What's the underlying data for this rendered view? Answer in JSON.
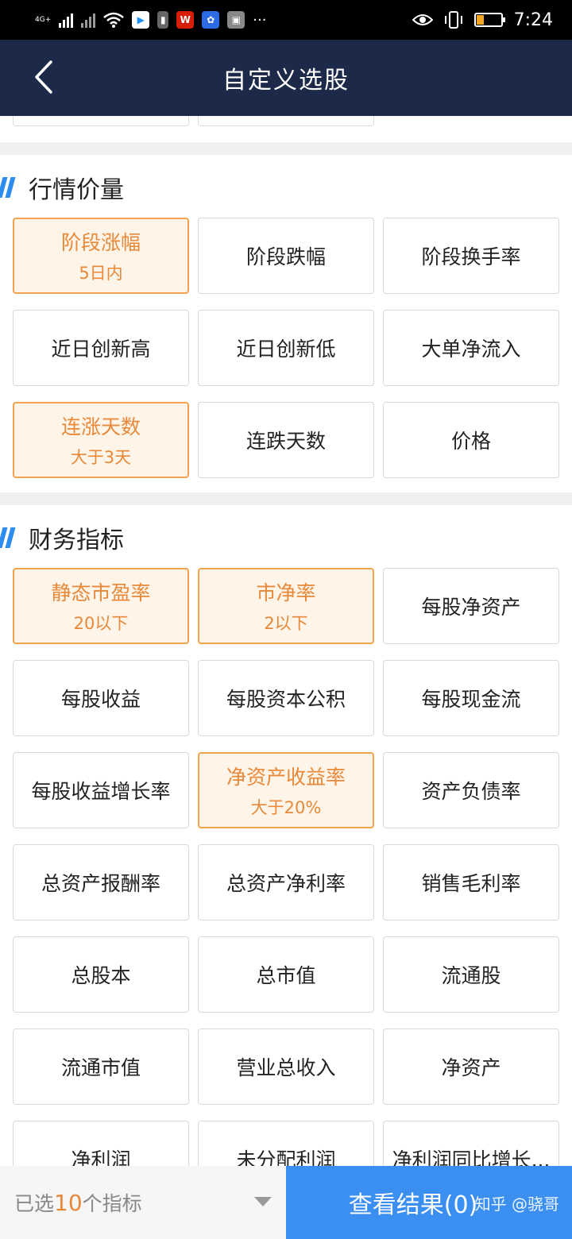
{
  "status_bar": {
    "network": "4G+",
    "time": "7:24",
    "icons": [
      "signal-icon",
      "wifi-icon",
      "youku-icon",
      "sim-icon",
      "wps-icon",
      "baidu-icon",
      "briefcase-icon",
      "more-dots-icon",
      "eye-icon",
      "vibrate-icon",
      "battery-icon"
    ]
  },
  "nav": {
    "title": "自定义选股",
    "back_icon": "chevron-left-icon"
  },
  "sections": [
    {
      "title": "行情价量",
      "items": [
        {
          "label": "阶段涨幅",
          "sub": "5日内",
          "selected": true
        },
        {
          "label": "阶段跌幅",
          "sub": "",
          "selected": false
        },
        {
          "label": "阶段换手率",
          "sub": "",
          "selected": false
        },
        {
          "label": "近日创新高",
          "sub": "",
          "selected": false
        },
        {
          "label": "近日创新低",
          "sub": "",
          "selected": false
        },
        {
          "label": "大单净流入",
          "sub": "",
          "selected": false
        },
        {
          "label": "连涨天数",
          "sub": "大于3天",
          "selected": true
        },
        {
          "label": "连跌天数",
          "sub": "",
          "selected": false
        },
        {
          "label": "价格",
          "sub": "",
          "selected": false
        }
      ]
    },
    {
      "title": "财务指标",
      "items": [
        {
          "label": "静态市盈率",
          "sub": "20以下",
          "selected": true
        },
        {
          "label": "市净率",
          "sub": "2以下",
          "selected": true
        },
        {
          "label": "每股净资产",
          "sub": "",
          "selected": false
        },
        {
          "label": "每股收益",
          "sub": "",
          "selected": false
        },
        {
          "label": "每股资本公积",
          "sub": "",
          "selected": false
        },
        {
          "label": "每股现金流",
          "sub": "",
          "selected": false
        },
        {
          "label": "每股收益增长率",
          "sub": "",
          "selected": false
        },
        {
          "label": "净资产收益率",
          "sub": "大于20%",
          "selected": true
        },
        {
          "label": "资产负债率",
          "sub": "",
          "selected": false
        },
        {
          "label": "总资产报酬率",
          "sub": "",
          "selected": false
        },
        {
          "label": "总资产净利率",
          "sub": "",
          "selected": false
        },
        {
          "label": "销售毛利率",
          "sub": "",
          "selected": false
        },
        {
          "label": "总股本",
          "sub": "",
          "selected": false
        },
        {
          "label": "总市值",
          "sub": "",
          "selected": false
        },
        {
          "label": "流通股",
          "sub": "",
          "selected": false
        },
        {
          "label": "流通市值",
          "sub": "",
          "selected": false
        },
        {
          "label": "营业总收入",
          "sub": "",
          "selected": false
        },
        {
          "label": "净资产",
          "sub": "",
          "selected": false
        },
        {
          "label": "净利润",
          "sub": "",
          "selected": false
        },
        {
          "label": "未分配利润",
          "sub": "",
          "selected": false
        },
        {
          "label": "净利润同比增长...",
          "sub": "",
          "selected": false
        }
      ]
    }
  ],
  "bottom": {
    "summary_prefix": "已选",
    "summary_count": "10",
    "summary_suffix": "个指标",
    "view_button": "查看结果(0)",
    "watermark": "知乎 @骁哥"
  },
  "colors": {
    "nav_bg": "#1c2948",
    "accent_blue": "#3a8ff0",
    "selected_border": "#f0a24f",
    "selected_text": "#e8893a",
    "selected_bg": "#fff4e8"
  }
}
